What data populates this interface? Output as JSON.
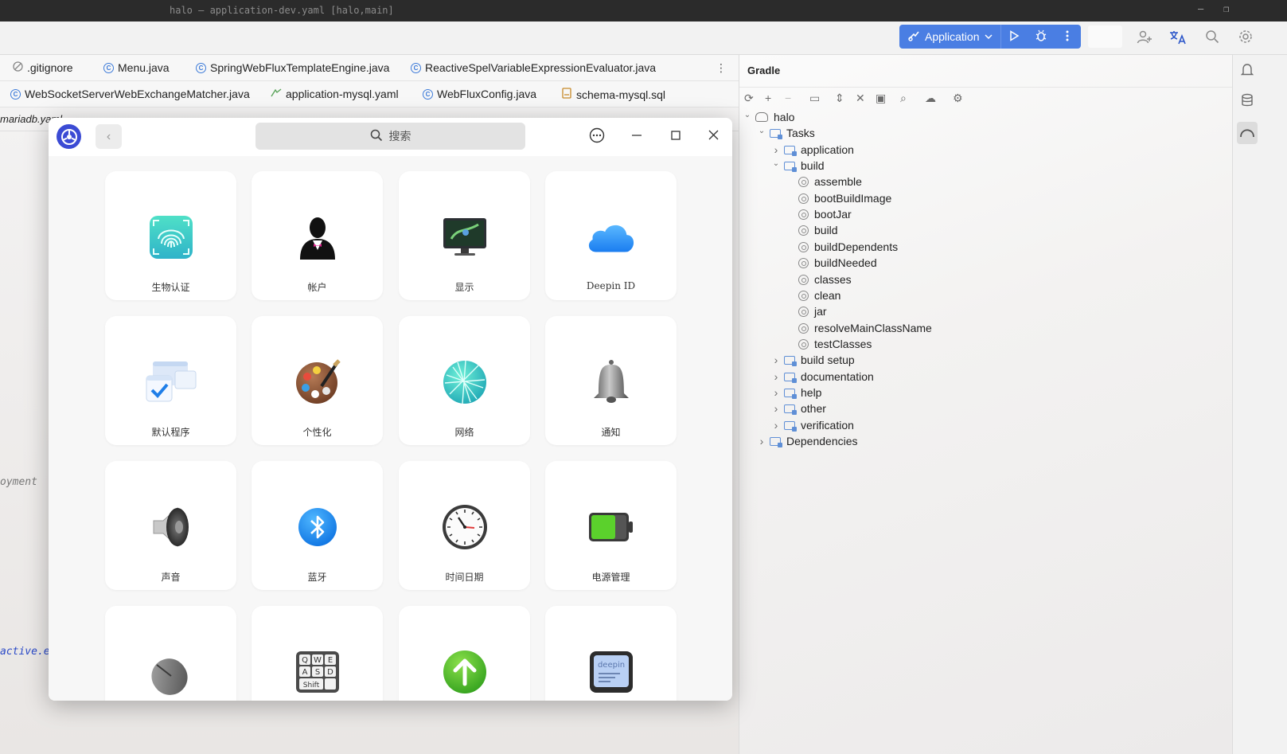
{
  "window": {
    "title": "halo – application-dev.yaml [halo,main]"
  },
  "toolbar": {
    "run_config_label": "Application",
    "icons": [
      "run-config-icon",
      "chevron-down-icon",
      "run-icon",
      "debug-icon",
      "more-vert-icon",
      "add-user-icon",
      "translate-icon",
      "search-icon",
      "gear-icon"
    ]
  },
  "editor": {
    "tabs_row1": [
      {
        "label": ".gitignore",
        "icon": "ignore-file-icon"
      },
      {
        "label": "Menu.java",
        "icon": "class-icon"
      },
      {
        "label": "SpringWebFluxTemplateEngine.java",
        "icon": "class-icon"
      },
      {
        "label": "ReactiveSpelVariableExpressionEvaluator.java",
        "icon": "class-icon"
      }
    ],
    "tabs_row2": [
      {
        "label": "WebSocketServerWebExchangeMatcher.java",
        "icon": "class-icon"
      },
      {
        "label": "application-mysql.yaml",
        "icon": "yaml-icon"
      },
      {
        "label": "WebFluxConfig.java",
        "icon": "class-icon"
      },
      {
        "label": "schema-mysql.sql",
        "icon": "sql-icon"
      }
    ],
    "partial_tab": "mariadb.yaml",
    "code_fragments": [
      "oyment",
      "active.e"
    ]
  },
  "gradle": {
    "title": "Gradle",
    "tree": [
      {
        "label": "halo",
        "level": 0,
        "kind": "root",
        "expanded": true
      },
      {
        "label": "Tasks",
        "level": 1,
        "kind": "folder",
        "expanded": true
      },
      {
        "label": "application",
        "level": 2,
        "kind": "folder",
        "expanded": false
      },
      {
        "label": "build",
        "level": 2,
        "kind": "folder",
        "expanded": true
      },
      {
        "label": "assemble",
        "level": 3,
        "kind": "task"
      },
      {
        "label": "bootBuildImage",
        "level": 3,
        "kind": "task"
      },
      {
        "label": "bootJar",
        "level": 3,
        "kind": "task"
      },
      {
        "label": "build",
        "level": 3,
        "kind": "task"
      },
      {
        "label": "buildDependents",
        "level": 3,
        "kind": "task"
      },
      {
        "label": "buildNeeded",
        "level": 3,
        "kind": "task"
      },
      {
        "label": "classes",
        "level": 3,
        "kind": "task"
      },
      {
        "label": "clean",
        "level": 3,
        "kind": "task"
      },
      {
        "label": "jar",
        "level": 3,
        "kind": "task"
      },
      {
        "label": "resolveMainClassName",
        "level": 3,
        "kind": "task"
      },
      {
        "label": "testClasses",
        "level": 3,
        "kind": "task"
      },
      {
        "label": "build setup",
        "level": 2,
        "kind": "folder",
        "expanded": false
      },
      {
        "label": "documentation",
        "level": 2,
        "kind": "folder",
        "expanded": false
      },
      {
        "label": "help",
        "level": 2,
        "kind": "folder",
        "expanded": false
      },
      {
        "label": "other",
        "level": 2,
        "kind": "folder",
        "expanded": false
      },
      {
        "label": "verification",
        "level": 2,
        "kind": "folder",
        "expanded": false
      },
      {
        "label": "Dependencies",
        "level": 1,
        "kind": "folder",
        "expanded": false
      }
    ]
  },
  "settings": {
    "search_placeholder": "搜索",
    "modules": [
      {
        "label": "生物认证",
        "icon": "fingerprint-icon"
      },
      {
        "label": "帐户",
        "icon": "account-icon"
      },
      {
        "label": "显示",
        "icon": "display-icon"
      },
      {
        "label": "Deepin ID",
        "icon": "cloud-icon"
      },
      {
        "label": "默认程序",
        "icon": "default-apps-icon"
      },
      {
        "label": "个性化",
        "icon": "palette-icon"
      },
      {
        "label": "网络",
        "icon": "network-icon"
      },
      {
        "label": "通知",
        "icon": "bell-icon"
      },
      {
        "label": "声音",
        "icon": "speaker-icon"
      },
      {
        "label": "蓝牙",
        "icon": "bluetooth-icon"
      },
      {
        "label": "时间日期",
        "icon": "clock-icon"
      },
      {
        "label": "电源管理",
        "icon": "battery-icon"
      },
      {
        "label": "",
        "icon": "mouse-icon"
      },
      {
        "label": "",
        "icon": "keyboard-icon"
      },
      {
        "label": "",
        "icon": "update-icon"
      },
      {
        "label": "",
        "icon": "system-info-icon"
      }
    ],
    "keyboard_keys": [
      "Q",
      "W",
      "E",
      "A",
      "S",
      "D",
      "Shift"
    ],
    "system_info_brand": "deepin"
  },
  "colors": {
    "accent": "#4a7ee3",
    "titlebar": "#2b2b2b",
    "deepin_logo": "#3b4bd4"
  }
}
